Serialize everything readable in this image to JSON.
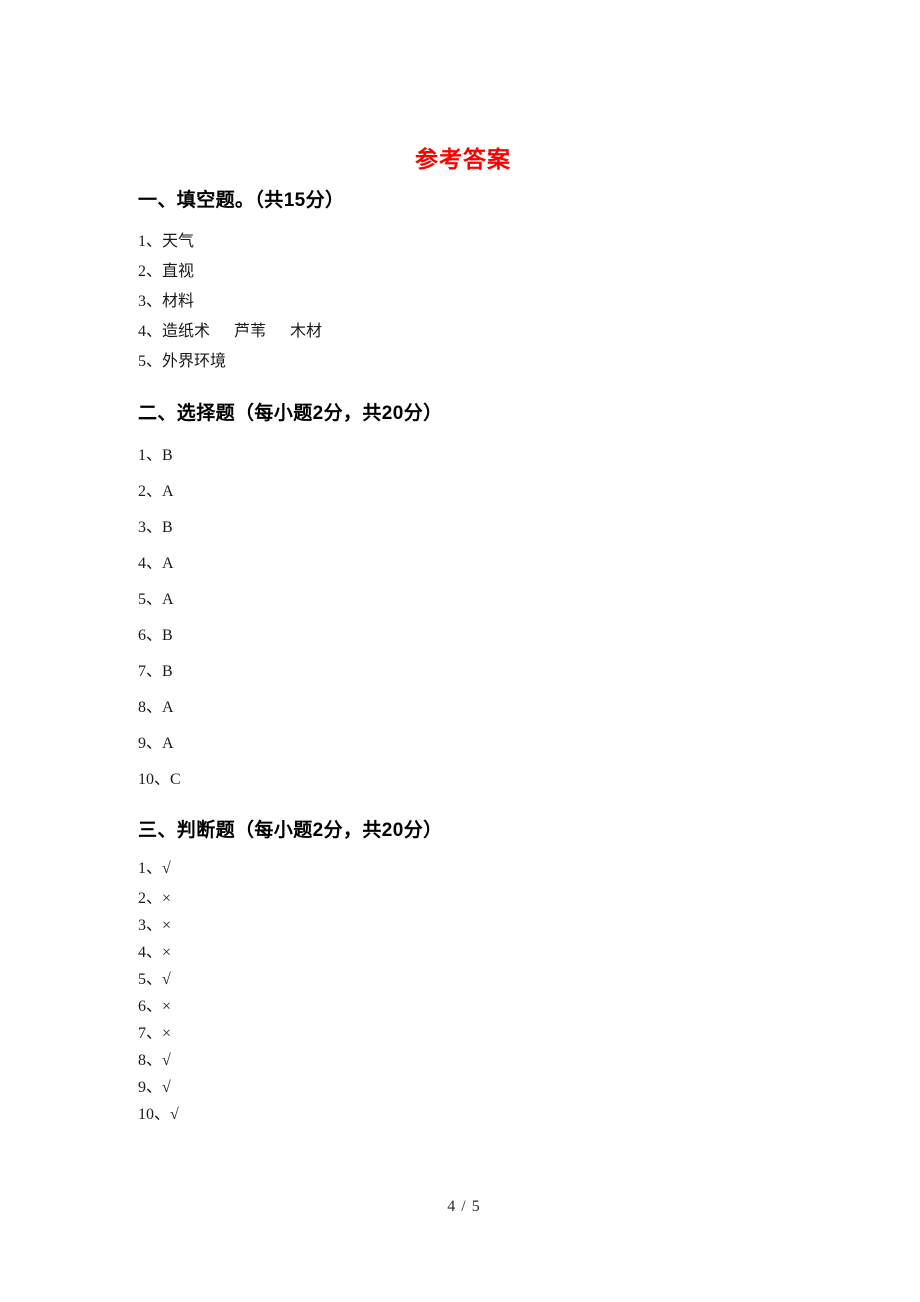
{
  "document": {
    "title": "参考答案",
    "title_color": "#ff0000"
  },
  "sections": [
    {
      "id": "fill-in-the-blank",
      "heading": "一、填空题。（共15分）",
      "items": [
        {
          "num": "1、",
          "value": "天气"
        },
        {
          "num": "2、",
          "value": "直视"
        },
        {
          "num": "3、",
          "value": "材料"
        },
        {
          "num": "4、",
          "value": "造纸术      芦苇      木材"
        },
        {
          "num": "5、",
          "value": "外界环境"
        }
      ]
    },
    {
      "id": "multiple-choice",
      "heading": "二、选择题（每小题2分，共20分）",
      "items": [
        {
          "num": "1、",
          "value": "B"
        },
        {
          "num": "2、",
          "value": "A"
        },
        {
          "num": "3、",
          "value": "B"
        },
        {
          "num": "4、",
          "value": "A"
        },
        {
          "num": "5、",
          "value": "A"
        },
        {
          "num": "6、",
          "value": "B"
        },
        {
          "num": "7、",
          "value": "B"
        },
        {
          "num": "8、",
          "value": "A"
        },
        {
          "num": "9、",
          "value": "A"
        },
        {
          "num": "10、",
          "value": "C"
        }
      ]
    },
    {
      "id": "true-false",
      "heading": "三、判断题（每小题2分，共20分）",
      "items": [
        {
          "num": "1、",
          "value": "√"
        },
        {
          "num": "2、",
          "value": "×"
        },
        {
          "num": "3、",
          "value": "×"
        },
        {
          "num": "4、",
          "value": "×"
        },
        {
          "num": "5、",
          "value": "√"
        },
        {
          "num": "6、",
          "value": "×"
        },
        {
          "num": "7、",
          "value": "×"
        },
        {
          "num": "8、",
          "value": "√"
        },
        {
          "num": "9、",
          "value": "√"
        },
        {
          "num": "10、",
          "value": "√"
        }
      ]
    }
  ],
  "footer": {
    "page_number": "4 / 5"
  }
}
